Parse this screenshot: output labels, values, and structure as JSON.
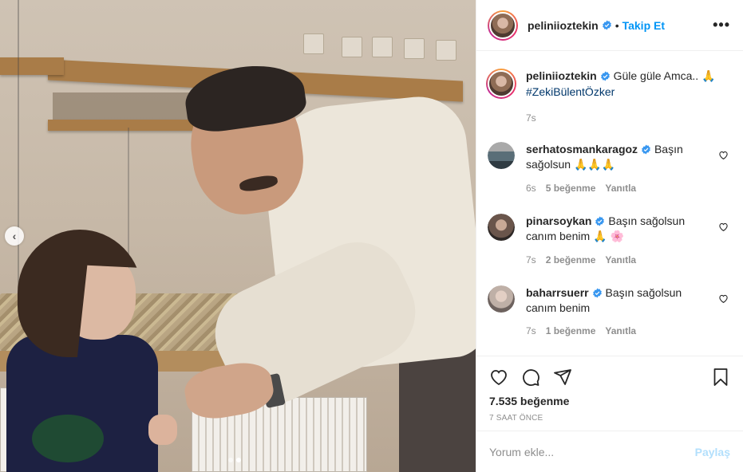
{
  "post": {
    "author": {
      "username": "peliniioztekin",
      "verified": true,
      "follow_label": "Takip Et",
      "separator": "•"
    },
    "caption": {
      "text": "Güle güle Amca..",
      "emoji": "🙏",
      "hashtag": "#ZekiBülentÖzker",
      "time": "7s"
    },
    "comments": [
      {
        "username": "serhatosmankaragoz",
        "verified": true,
        "text": "Başın sağolsun",
        "emoji": "🙏🙏🙏",
        "time": "6s",
        "likes": "5 beğenme",
        "reply": "Yanıtla"
      },
      {
        "username": "pinarsoykan",
        "verified": true,
        "text": "Başın sağolsun canım benim",
        "emoji": "🙏 🌸",
        "time": "7s",
        "likes": "2 beğenme",
        "reply": "Yanıtla"
      },
      {
        "username": "baharrsuerr",
        "verified": true,
        "text": "Başın sağolsun canım benim",
        "emoji": "",
        "time": "7s",
        "likes": "1 beğenme",
        "reply": "Yanıtla"
      }
    ],
    "likes": "7.535 beğenme",
    "posted_ago": "7 SAAT ÖNCE",
    "add_comment": {
      "placeholder": "Yorum ekle...",
      "post_label": "Paylaş"
    },
    "carousel": {
      "prev_icon": "‹",
      "slide_count": 2,
      "active_slide": 2
    },
    "icons": [
      "heart-icon",
      "comment-icon",
      "share-icon",
      "bookmark-icon",
      "more-icon",
      "verified-icon",
      "chevron-left-icon"
    ],
    "colors": {
      "link_blue": "#0095f6",
      "verified_blue": "#3897f0",
      "muted": "#8e8e8e",
      "post_disabled": "#b2dffc"
    }
  }
}
